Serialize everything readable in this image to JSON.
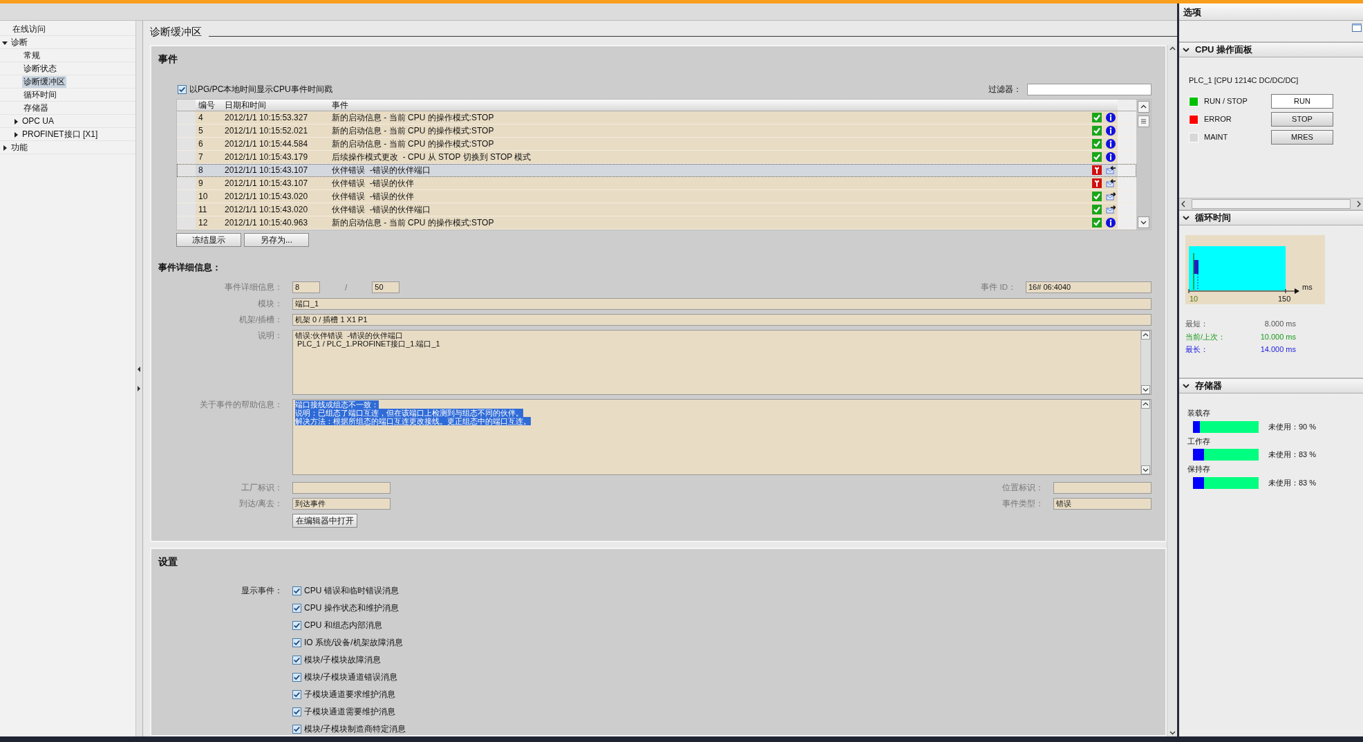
{
  "sidebar": {
    "items": [
      {
        "label": "在线访问",
        "selected": false
      },
      {
        "label": "诊断",
        "selected": false,
        "expanded": true,
        "children": [
          {
            "label": "常规",
            "selected": false
          },
          {
            "label": "诊断状态",
            "selected": false
          },
          {
            "label": "诊断缓冲区",
            "selected": true
          },
          {
            "label": "循环时间",
            "selected": false
          },
          {
            "label": "存储器",
            "selected": false
          },
          {
            "label": "OPC UA",
            "selected": false,
            "expanded": false
          },
          {
            "label": "PROFINET接口 [X1]",
            "selected": false,
            "expanded": false
          }
        ]
      },
      {
        "label": "功能",
        "selected": false,
        "expanded": false
      }
    ]
  },
  "page_title": "诊断缓冲区",
  "events": {
    "title": "事件",
    "local_time": {
      "label": "以PG/PC本地时间显示CPU事件时间戳",
      "checked": true
    },
    "filter": {
      "label": "过滤器："
    },
    "table": {
      "columns": [
        "编号",
        "日期和时间",
        "事件"
      ],
      "rows": [
        {
          "number": "4",
          "datetime": "2012/1/1 10:15:53.327",
          "event": "新的启动信息 - 当前 CPU 的操作模式:STOP",
          "error": false,
          "kind": "info",
          "selected": false
        },
        {
          "number": "5",
          "datetime": "2012/1/1 10:15:52.021",
          "event": "新的启动信息 - 当前 CPU 的操作模式:STOP",
          "error": false,
          "kind": "info",
          "selected": false
        },
        {
          "number": "6",
          "datetime": "2012/1/1 10:15:44.584",
          "event": "新的启动信息 - 当前 CPU 的操作模式:STOP",
          "error": false,
          "kind": "info",
          "selected": false
        },
        {
          "number": "7",
          "datetime": "2012/1/1 10:15:43.179",
          "event": "后续操作模式更改  - CPU 从 STOP 切换到 STOP 模式",
          "error": false,
          "kind": "info",
          "selected": false
        },
        {
          "number": "8",
          "datetime": "2012/1/1 10:15:43.107",
          "event": "伙伴错误  -错误的伙伴端口",
          "error": true,
          "kind": "incoming",
          "selected": true
        },
        {
          "number": "9",
          "datetime": "2012/1/1 10:15:43.107",
          "event": "伙伴错误  -错误的伙伴",
          "error": true,
          "kind": "incoming",
          "selected": false
        },
        {
          "number": "10",
          "datetime": "2012/1/1 10:15:43.020",
          "event": "伙伴错误  -错误的伙伴",
          "error": false,
          "kind": "outgoing",
          "selected": false
        },
        {
          "number": "11",
          "datetime": "2012/1/1 10:15:43.020",
          "event": "伙伴错误  -错误的伙伴端口",
          "error": false,
          "kind": "outgoing",
          "selected": false
        },
        {
          "number": "12",
          "datetime": "2012/1/1 10:15:40.963",
          "event": "新的启动信息 - 当前 CPU 的操作模式:STOP",
          "error": false,
          "kind": "info",
          "selected": false
        }
      ]
    },
    "buttons": [
      "冻结显示",
      "另存为..."
    ]
  },
  "details": {
    "title": "事件详细信息：",
    "event_no": {
      "label": "事件详细信息：",
      "value": "8",
      "separator": "/",
      "total": "50"
    },
    "event_id": {
      "label": "事件 ID：",
      "value": "16# 06:4040"
    },
    "module": {
      "label": "模块：",
      "value": "端口_1"
    },
    "rack_slot": {
      "label": "机架/插槽：",
      "value": "机架 0 / 插槽 1 X1 P1"
    },
    "description": {
      "label": "说明：",
      "lines": [
        "错误:伙伴错误  -错误的伙伴端口",
        " PLC_1 / PLC_1.PROFINET接口_1.端口_1"
      ]
    },
    "help": {
      "label": "关于事件的帮助信息：",
      "text_selected": true,
      "lines": [
        "端口接线或组态不一致：",
        "说明：已组态了端口互连，但在该端口上检测到与组态不同的伙伴。",
        "解决方法：根据所组态的端口互连更改接线。更正组态中的端口互连。"
      ]
    },
    "plant_id": {
      "label": "工厂标识："
    },
    "location_id": {
      "label": "位置标识："
    },
    "arrive_leave": {
      "label": "到达/离去：",
      "value": "到达事件"
    },
    "event_type": {
      "label": "事件类型：",
      "value": "错误"
    },
    "open_button": "在编辑器中打开"
  },
  "settings": {
    "title": "设置",
    "label": "显示事件：",
    "options": [
      {
        "label": "CPU 错误和临时错误消息",
        "checked": true
      },
      {
        "label": "CPU 操作状态和维护消息",
        "checked": true
      },
      {
        "label": "CPU 和组态内部消息",
        "checked": true
      },
      {
        "label": "IO 系统/设备/机架故障消息",
        "checked": true
      },
      {
        "label": "模块/子模块故障消息",
        "checked": true
      },
      {
        "label": "模块/子模块通道错误消息",
        "checked": true
      },
      {
        "label": "子模块通道要求维护消息",
        "checked": true
      },
      {
        "label": "子模块通道需要维护消息",
        "checked": true
      },
      {
        "label": "模块/子模块制造商特定消息",
        "checked": true
      }
    ]
  },
  "options_panel": {
    "title": "选项",
    "cpu_panel": {
      "title": "CPU 操作面板",
      "expanded": true,
      "plc": "PLC_1 [CPU 1214C DC/DC/DC]",
      "rows": [
        {
          "label": "RUN / STOP",
          "color": "#00c000",
          "button": "RUN",
          "selected": true
        },
        {
          "label": "ERROR",
          "color": "#ff0000",
          "button": "STOP",
          "selected": false
        },
        {
          "label": "MAINT",
          "color": "#d8d8d8",
          "button": "MRES",
          "selected": false
        }
      ]
    },
    "cycle_time": {
      "title": "循环时间",
      "expanded": true,
      "axis_min": "10",
      "axis_max": "150",
      "unit": "ms",
      "stats": [
        {
          "kind": "min",
          "label": "最短：",
          "value": "8.000 ms"
        },
        {
          "kind": "current",
          "label": "当前/上次：",
          "value": "10.000 ms"
        },
        {
          "kind": "max",
          "label": "最长：",
          "value": "14.000 ms"
        }
      ]
    },
    "memory": {
      "title": "存储器",
      "expanded": true,
      "items": [
        {
          "label": "装载存",
          "level": 0.1,
          "reading": "未使用：90 %"
        },
        {
          "label": "工作存",
          "level": 0.17,
          "reading": "未使用：83 %"
        },
        {
          "label": "保持存",
          "level": 0.17,
          "reading": "未使用：83 %"
        }
      ]
    }
  }
}
